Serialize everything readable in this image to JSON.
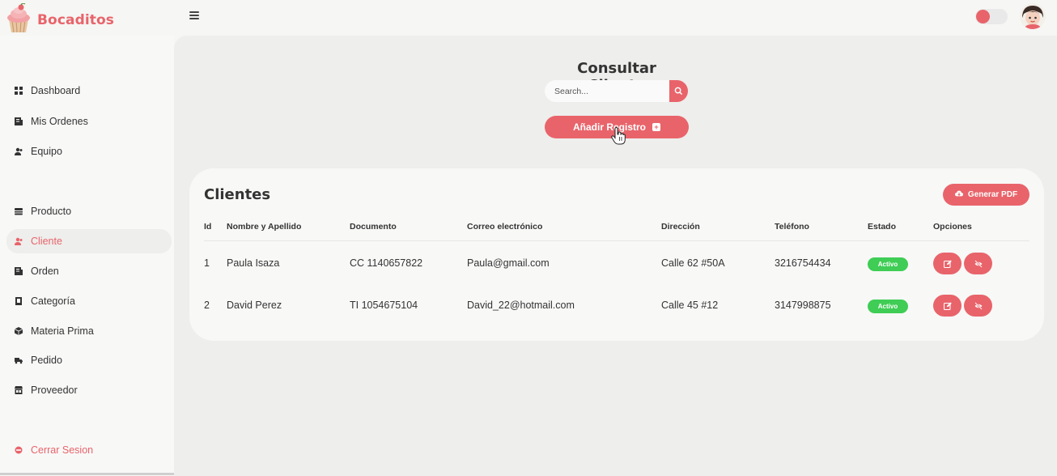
{
  "app": {
    "name": "Bocaditos"
  },
  "sidebar": {
    "items": [
      {
        "label": "Dashboard",
        "icon": "dashboard-icon"
      },
      {
        "label": "Mis Ordenes",
        "icon": "orders-icon"
      },
      {
        "label": "Equipo",
        "icon": "team-icon"
      },
      {
        "label": "Producto",
        "icon": "product-icon"
      },
      {
        "label": "Cliente",
        "icon": "client-icon",
        "active": true
      },
      {
        "label": "Orden",
        "icon": "order-icon"
      },
      {
        "label": "Categoría",
        "icon": "category-icon"
      },
      {
        "label": "Materia Prima",
        "icon": "raw-material-icon"
      },
      {
        "label": "Pedido",
        "icon": "truck-icon"
      },
      {
        "label": "Proveedor",
        "icon": "supplier-icon"
      }
    ],
    "logout": {
      "label": "Cerrar Sesion",
      "icon": "logout-icon"
    }
  },
  "main": {
    "title": "Consultar Cliente",
    "search": {
      "placeholder": "Search..."
    },
    "add_button": "Añadir Registro"
  },
  "clients": {
    "title": "Clientes",
    "pdf_button": "Generar PDF",
    "columns": [
      "Id",
      "Nombre y Apellido",
      "Documento",
      "Correo electrónico",
      "Dirección",
      "Teléfono",
      "Estado",
      "Opciones"
    ],
    "rows": [
      {
        "id": "1",
        "name": "Paula Isaza",
        "document": "CC 1140657822",
        "email": "Paula@gmail.com",
        "address": "Calle 62 #50A",
        "phone": "3216754434",
        "status": "Activo"
      },
      {
        "id": "2",
        "name": "David Perez",
        "document": "TI 1054675104",
        "email": "David_22@hotmail.com",
        "address": "Calle 45 #12",
        "phone": "3147998875",
        "status": "Activo"
      }
    ]
  },
  "colors": {
    "accent": "#e8646a",
    "active_badge": "#3fcd55",
    "background": "#eeeeec",
    "panel": "#f8f8f7"
  }
}
